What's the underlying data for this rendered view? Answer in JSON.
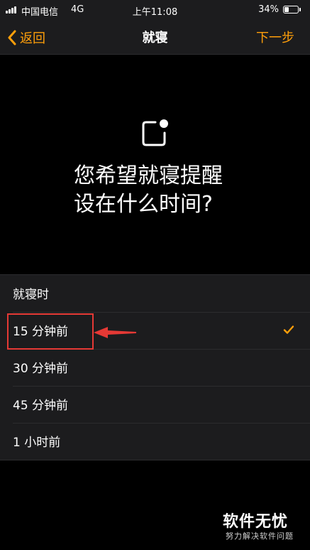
{
  "status_bar": {
    "carrier": "中国电信",
    "network": "4G",
    "time": "上午11:08",
    "battery_percent": "34%",
    "battery_level": 0.34
  },
  "nav": {
    "back_label": "返回",
    "title": "就寝",
    "next_label": "下一步"
  },
  "prompt": {
    "line1": "您希望就寝提醒",
    "line2": "设在什么时间?"
  },
  "options": [
    {
      "label": "就寝时",
      "selected": false
    },
    {
      "label": "15 分钟前",
      "selected": true
    },
    {
      "label": "30 分钟前",
      "selected": false
    },
    {
      "label": "45 分钟前",
      "selected": false
    },
    {
      "label": "1 小时前",
      "selected": false
    }
  ],
  "colors": {
    "accent": "#ff9f0a",
    "annotation_red": "#e53935"
  },
  "watermark": {
    "main": "软件无忧",
    "sub": "努力解决软件问题"
  }
}
